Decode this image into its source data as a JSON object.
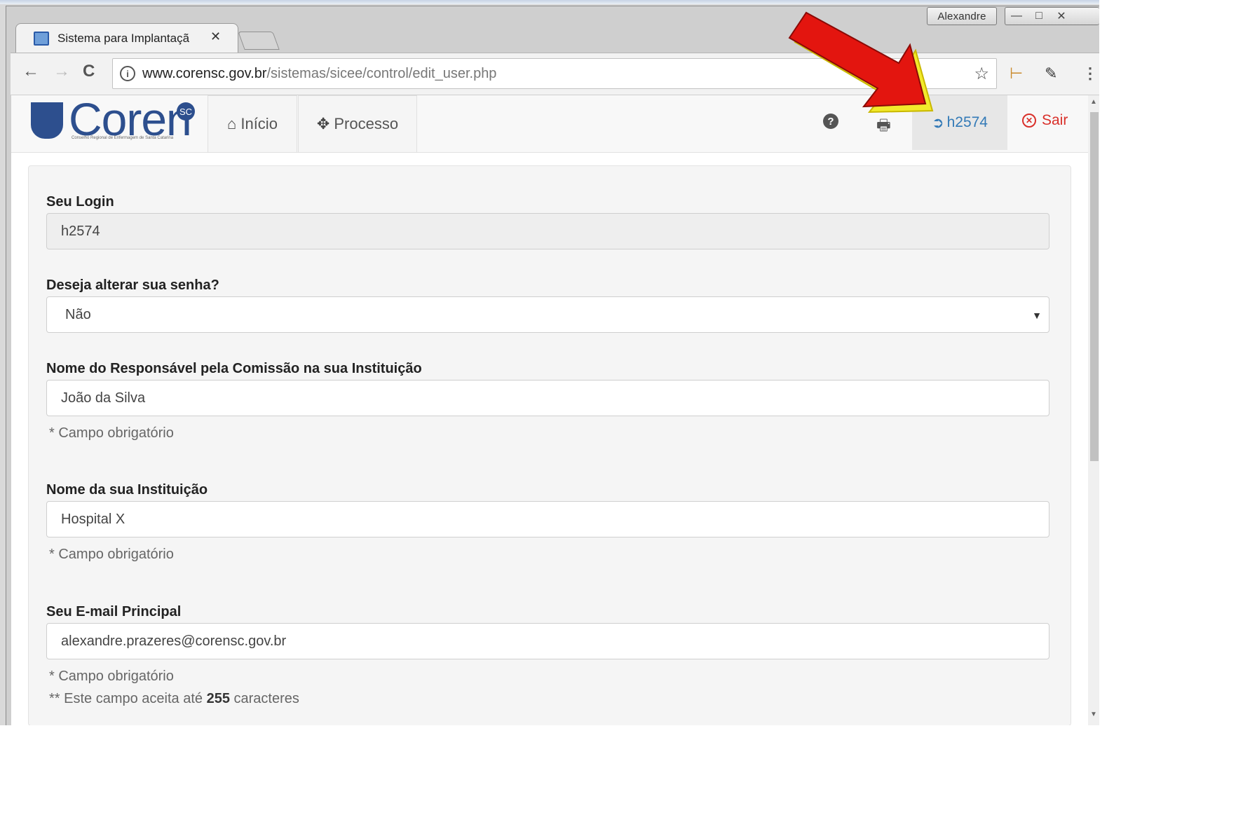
{
  "window": {
    "user_label": "Alexandre",
    "controls": [
      "—",
      "□",
      "✕"
    ]
  },
  "tab": {
    "title": "Sistema para Implantaçã",
    "close": "✕"
  },
  "toolbar": {
    "back": "←",
    "forward": "→",
    "reload": "C",
    "url_domain": "www.corensc.gov.br",
    "url_path": "/sistemas/sicee/control/edit_user.php",
    "star": "☆"
  },
  "site": {
    "logo_text": "Coren",
    "logo_badge": "SC",
    "logo_sub": "Conselho Regional de Enfermagem de Santa Catarina",
    "nav": [
      {
        "icon": "⌂",
        "label": "Início"
      },
      {
        "icon": "✥",
        "label": "Processo"
      }
    ],
    "help_icon": "?",
    "print_icon": "🖶",
    "user_link": "h2574",
    "user_link_icon": "➲",
    "logout_label": "Sair"
  },
  "form": {
    "login": {
      "label": "Seu Login",
      "value": "h2574"
    },
    "change_password": {
      "label": "Deseja alterar sua senha?",
      "value": "Não"
    },
    "responsible": {
      "label": "Nome do Responsável pela Comissão na sua Instituição",
      "value": "João da Silva",
      "help": "* Campo obrigatório"
    },
    "institution": {
      "label": "Nome da sua Instituição",
      "value": "Hospital X",
      "help": "* Campo obrigatório"
    },
    "email": {
      "label": "Seu E-mail Principal",
      "value": "alexandre.prazeres@corensc.gov.br",
      "help": "* Campo obrigatório",
      "help2_prefix": "** Este campo aceita até ",
      "help2_max": "255",
      "help2_suffix": " caracteres"
    }
  },
  "colors": {
    "link": "#337ab7",
    "danger": "#d9302a",
    "brand": "#2d4f8e"
  }
}
